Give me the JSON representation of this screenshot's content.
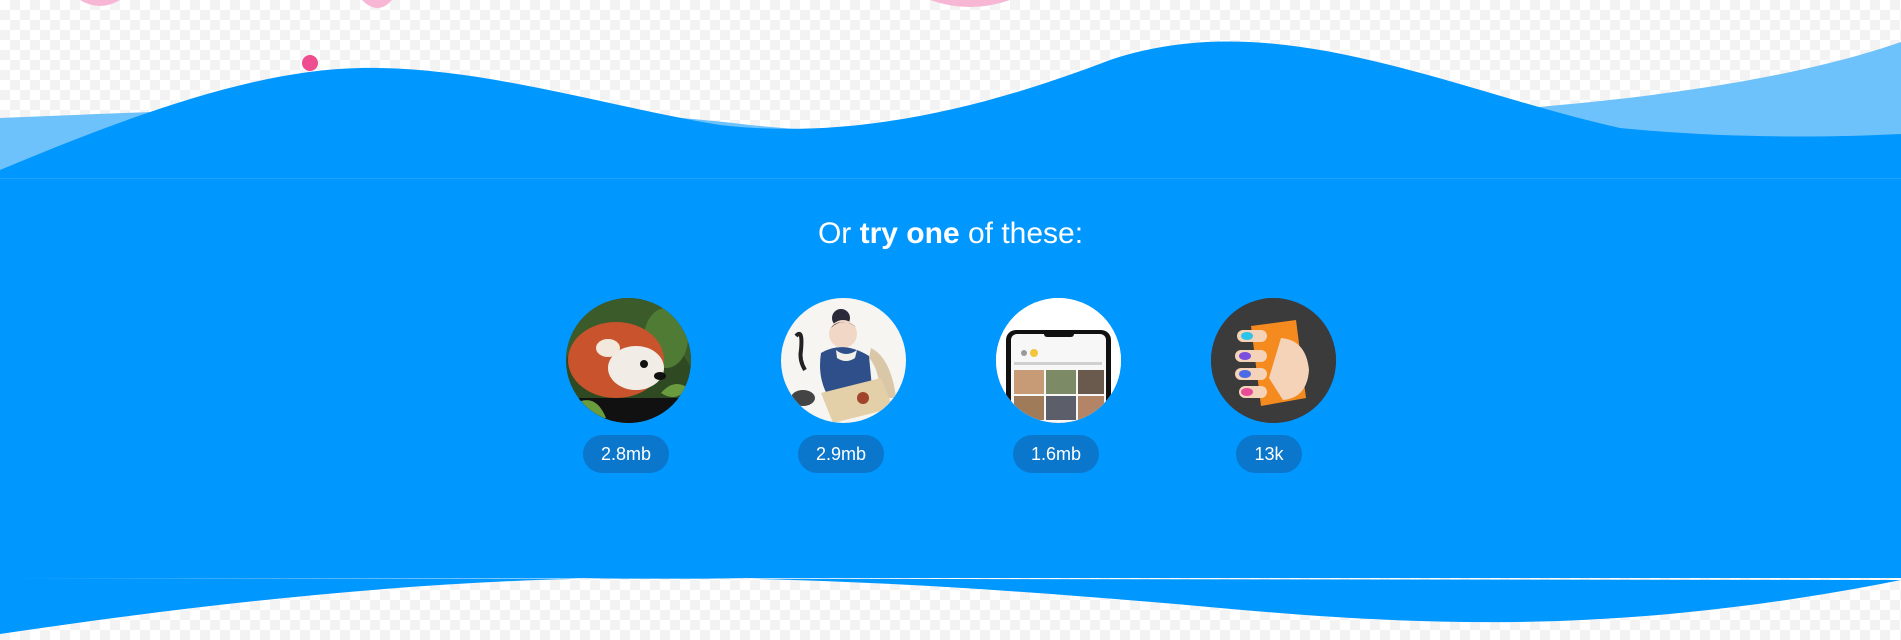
{
  "intro": {
    "before": "Or",
    "bold": "try one",
    "after": "of these:"
  },
  "demos": [
    {
      "image_icon": "red-panda-photo",
      "size": "2.8mb"
    },
    {
      "image_icon": "artwork-illustration",
      "size": "2.9mb"
    },
    {
      "image_icon": "phone-screenshot",
      "size": "1.6mb"
    },
    {
      "image_icon": "svg-hand-icon",
      "size": "13k"
    }
  ],
  "colors": {
    "wave_blue": "#0097ff",
    "wave_light": "#6ec2fb",
    "badge": "#0a76cc"
  }
}
